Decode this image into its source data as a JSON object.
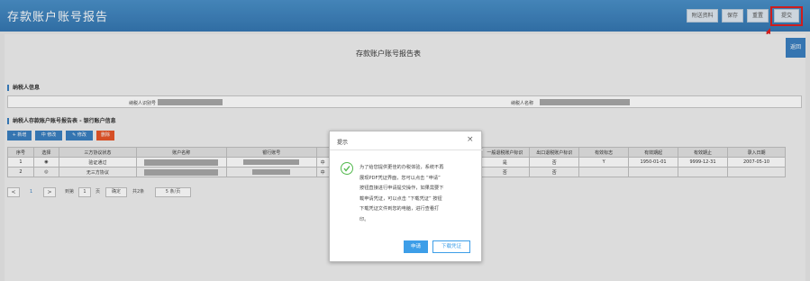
{
  "header": {
    "title": "存款账户账号报告",
    "buttons": [
      "附送资料",
      "保存",
      "重置",
      "提交"
    ]
  },
  "page": {
    "form_title": "存款账户账号报告表",
    "return_label": "返回"
  },
  "taxpayer": {
    "section_title": "纳税人信息",
    "id_label": "纳税人识别号",
    "name_label": "纳税人名称"
  },
  "accounts": {
    "section_title": "纳税人存款账户账号报告表 - 银行账户信息",
    "toolbar": [
      "+ 新增",
      "中 修改",
      "✎ 修改",
      "删除"
    ],
    "columns": [
      "序号",
      "选择",
      "三方协议状态",
      "账户名称",
      "银行账号",
      "",
      "一般退税账户标识",
      "出口退税账户标识",
      "有效标志",
      "有效期起",
      "有效期止",
      "录入日期"
    ],
    "rows": [
      {
        "seq": "1",
        "sel": "◉",
        "status": "验证通过",
        "col5": "中",
        "general": "是",
        "export": "否",
        "valid": "Y",
        "start": "1950-01-01",
        "end": "9999-12-31",
        "entry": "2007-05-10"
      },
      {
        "seq": "2",
        "sel": "◎",
        "status": "无三方协议",
        "col5": "中",
        "general": "否",
        "export": "否",
        "valid": "",
        "start": "",
        "end": "",
        "entry": ""
      }
    ]
  },
  "pagination": {
    "prev": "<",
    "page": "1",
    "next": ">",
    "goto_label": "到第",
    "goto_value": "1",
    "page_unit": "页",
    "confirm": "确定",
    "total": "共2条",
    "per_page": "5 条/页"
  },
  "dialog": {
    "title": "提示",
    "close": "×",
    "message": "为了给您提供更佳的办税体验，系统不再\n展现PDF凭证界面，您可以点击 “申请”\n按钮直接进行申请提交操作，如果需要下\n载申请凭证，可以点击 “下载凭证” 按钮\n下载凭证文件到您的电脑，进行查看打\n印。",
    "apply_button": "申请",
    "download_button": "下载凭证"
  }
}
